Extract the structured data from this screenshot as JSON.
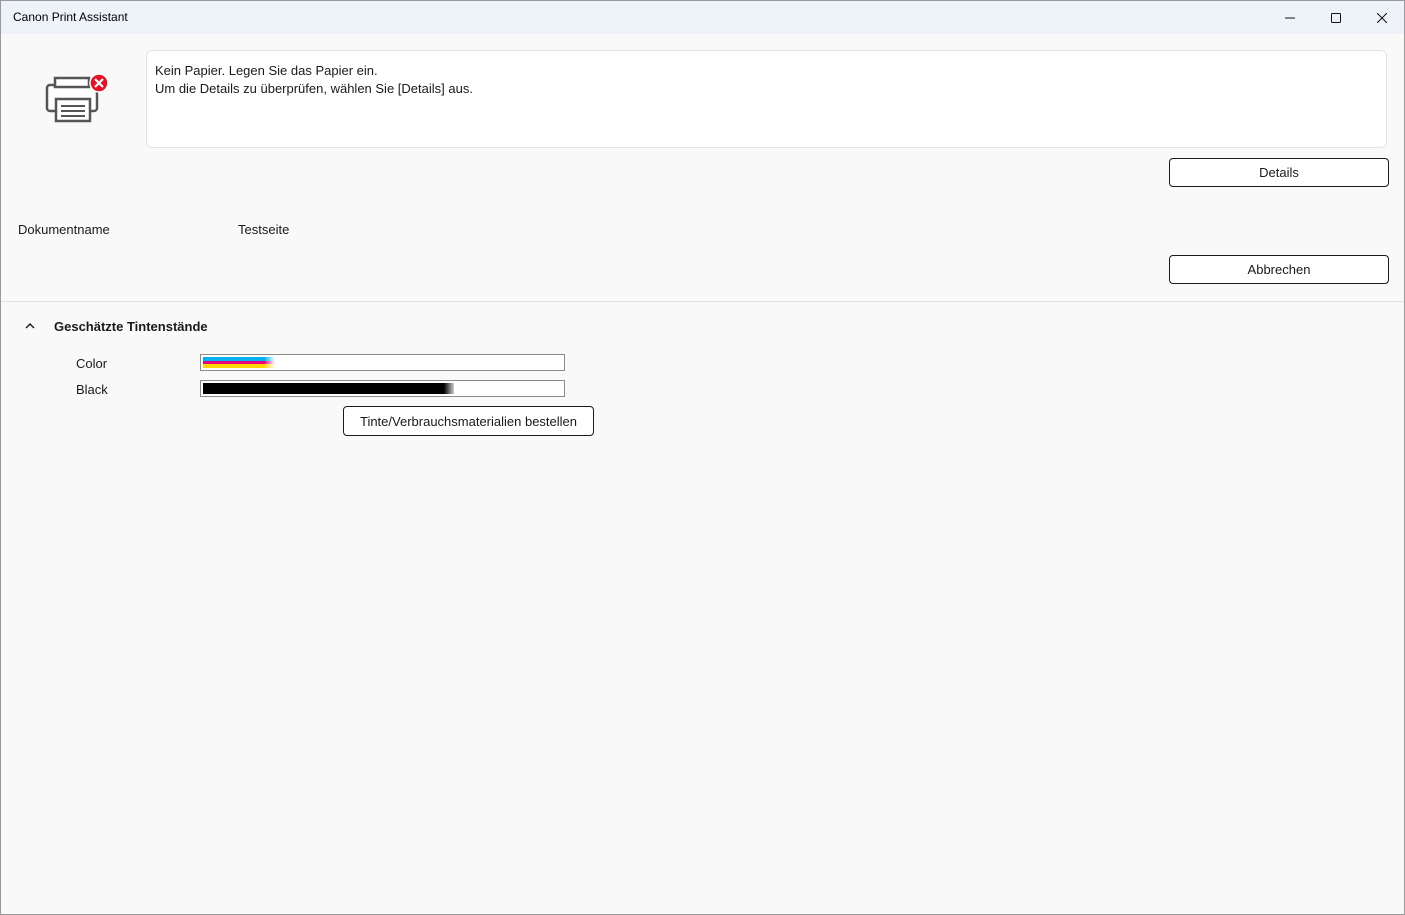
{
  "window": {
    "title": "Canon Print Assistant"
  },
  "status": {
    "icon": "printer-error-icon",
    "line1": "Kein Papier. Legen Sie das Papier ein.",
    "line2": "Um die Details zu überprüfen, wählen Sie [Details] aus."
  },
  "buttons": {
    "details": "Details",
    "cancel": "Abbrechen",
    "order": "Tinte/Verbrauchsmaterialien bestellen"
  },
  "document": {
    "label": "Dokumentname",
    "value": "Testseite"
  },
  "ink": {
    "title": "Geschätzte Tintenstände",
    "expanded": true,
    "items": [
      {
        "name": "Color",
        "level": 0.2,
        "colors": [
          "#00b0f0",
          "#e6007e",
          "#ffd600"
        ]
      },
      {
        "name": "Black",
        "level": 0.7,
        "colors": [
          "#000000"
        ]
      }
    ]
  },
  "colors": {
    "error": "#e81123",
    "titlebar": "#eef3f9"
  }
}
